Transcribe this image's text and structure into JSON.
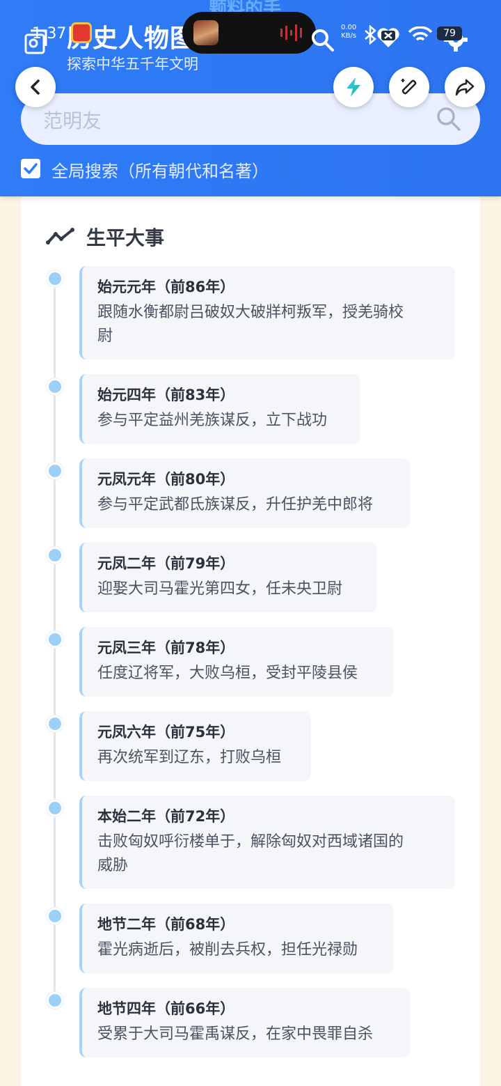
{
  "status_bar": {
    "time": "1:37",
    "net_speed_value": "0.00",
    "net_speed_unit": "KB/s",
    "battery": "79"
  },
  "header": {
    "ghost_text": "颗料的手",
    "title": "历史人物图",
    "subtitle": "探索中华五千年文明"
  },
  "search": {
    "value": "范明友",
    "placeholder": "范明友"
  },
  "global_search": {
    "checked": true,
    "label": "全局搜索（所有朝代和名著）"
  },
  "section": {
    "title": "生平大事"
  },
  "events": [
    {
      "year": "始元元年（前86年）",
      "desc_lines": [
        "跟随水衡都尉吕破奴大破牂柯叛军，授羌骑校",
        "尉"
      ]
    },
    {
      "year": "始元四年（前83年）",
      "desc_lines": [
        "参与平定益州羌族谋反，立下战功"
      ]
    },
    {
      "year": "元凤元年（前80年）",
      "desc_lines": [
        "参与平定武都氐族谋反，升任护羌中郎将"
      ]
    },
    {
      "year": "元凤二年（前79年）",
      "desc_lines": [
        "迎娶大司马霍光第四女，任未央卫尉"
      ]
    },
    {
      "year": "元凤三年（前78年）",
      "desc_lines": [
        "任度辽将军，大败乌桓，受封平陵县侯"
      ]
    },
    {
      "year": "元凤六年（前75年）",
      "desc_lines": [
        "再次统军到辽东，打败乌桓"
      ]
    },
    {
      "year": "本始二年（前72年）",
      "desc_lines": [
        "击败匈奴呼衍楼单于，解除匈奴对西域诸国的",
        "威胁"
      ]
    },
    {
      "year": "地节二年（前68年）",
      "desc_lines": [
        "霍光病逝后，被削去兵权，担任光禄勋"
      ]
    },
    {
      "year": "地节四年（前66年）",
      "desc_lines": [
        "受累于大司马霍禹谋反，在家中畏罪自杀"
      ]
    }
  ],
  "colors": {
    "header_blue": "#2f7cf6",
    "timeline_dot": "#9cd0f7",
    "timeline_accent": "#a9d3f6",
    "page_bg": "#fdf4e6"
  }
}
